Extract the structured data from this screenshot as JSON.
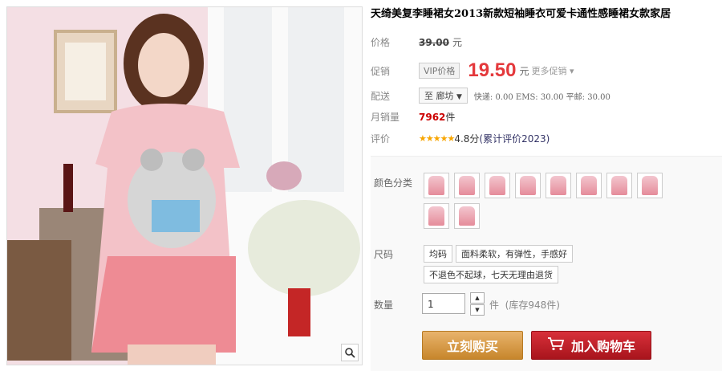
{
  "product": {
    "title": "天绮美复李睡裙女2013新款短袖睡衣可爱卡通性感睡裙女款家居"
  },
  "price": {
    "label": "价格",
    "original": "39.00",
    "unit": "元"
  },
  "promo": {
    "label": "促销",
    "vip_tag": "VIP价格",
    "price": "19.50",
    "unit": "元",
    "more": "更多促销"
  },
  "shipping": {
    "label": "配送",
    "destination": "至 廊坊",
    "info": "快递: 0.00 EMS: 30.00 平邮: 30.00"
  },
  "sales": {
    "label": "月销量",
    "count": "7962",
    "unit": "件"
  },
  "rating": {
    "label": "评价",
    "stars": "★★★★★",
    "score": "4.8分",
    "reviews": "(累计评价2023)"
  },
  "options": {
    "color_label": "颜色分类",
    "color_swatch_count": 10,
    "size_label": "尺码",
    "sizes": [
      "均码",
      "面料柔软，有弹性，手感好",
      "不退色不起球，七天无理由退货"
    ]
  },
  "quantity": {
    "label": "数量",
    "value": "1",
    "unit": "件",
    "stock": "(库存948件)"
  },
  "actions": {
    "buy_now": "立刻购买",
    "add_to_cart": "加入购物车"
  },
  "colors": {
    "promo_red": "#e4393c",
    "buy_button": "#c7862b",
    "cart_button": "#a8141c"
  }
}
